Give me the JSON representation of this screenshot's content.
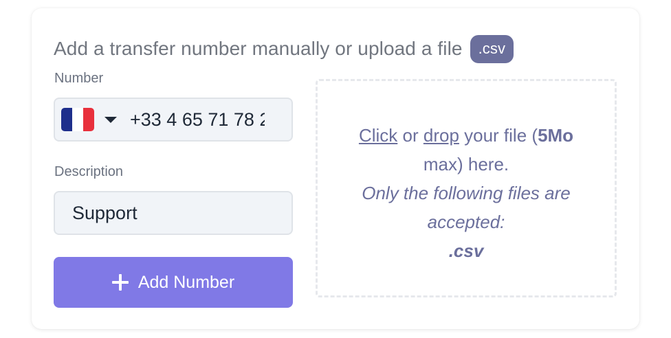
{
  "heading": {
    "text": "Add a transfer number manually or upload a file",
    "badge": ".csv"
  },
  "number_field": {
    "label": "Number",
    "country_flag": "France",
    "value": "+33 4 65 71 78 2"
  },
  "description_field": {
    "label": "Description",
    "value": "Support"
  },
  "add_button": {
    "icon": "plus-icon",
    "label": "Add Number"
  },
  "dropzone": {
    "click_text": "Click",
    "or_text": " or ",
    "drop_text": "drop",
    "your_file_text": " your file (",
    "size_text": "5Mo",
    "max_here_text": "max) here.",
    "accepted_line1": "Only the following files are",
    "accepted_line2": "accepted:",
    "extension": ".csv"
  },
  "colors": {
    "accent": "#8079e6",
    "badge": "#6b6f9c",
    "dropzone_text": "#6b6f9c",
    "flag_blue": "#1e2f8c",
    "flag_red": "#e8303c"
  }
}
